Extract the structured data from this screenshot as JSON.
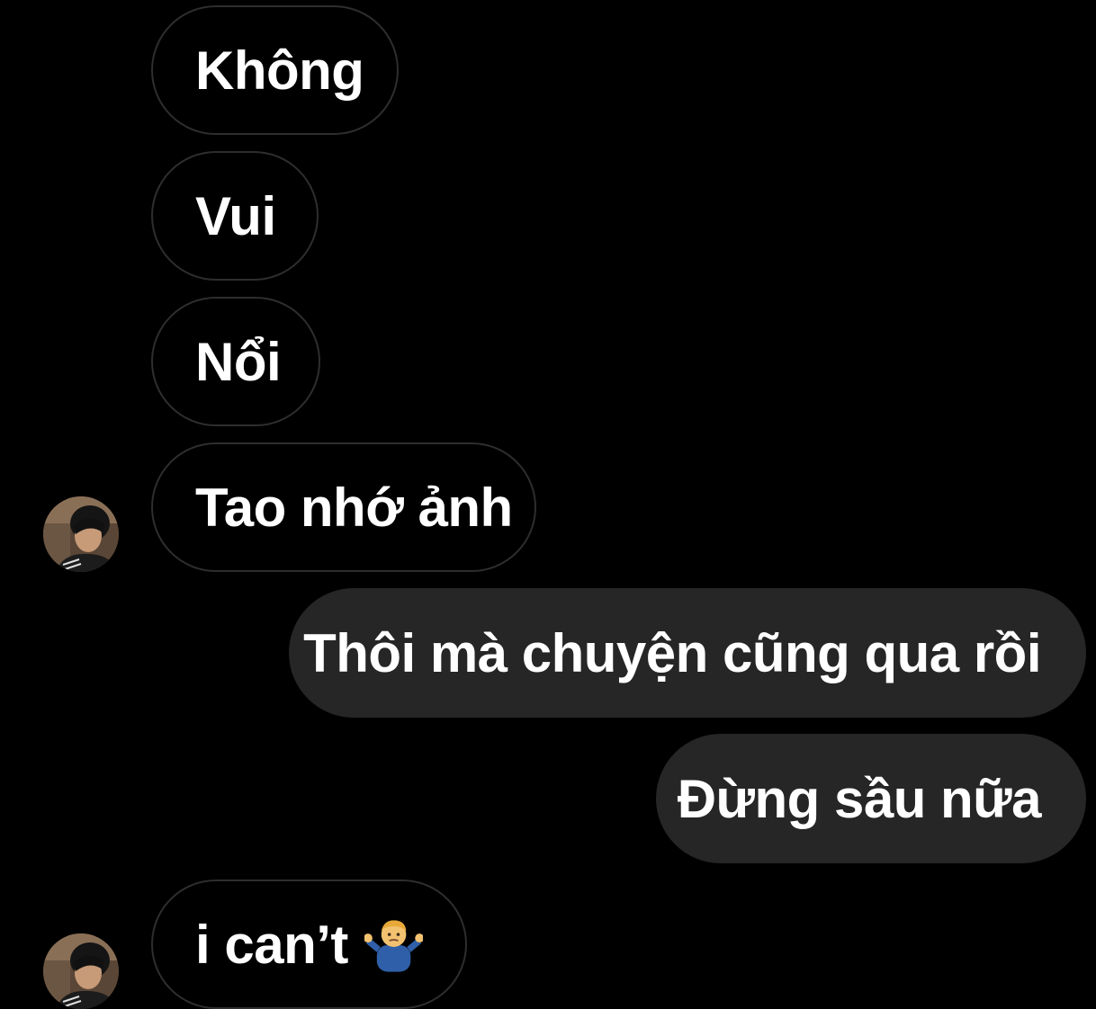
{
  "messages": [
    {
      "direction": "incoming",
      "text": "Không"
    },
    {
      "direction": "incoming",
      "text": "Vui"
    },
    {
      "direction": "incoming",
      "text": "Nổi"
    },
    {
      "direction": "incoming",
      "text": "Tao nhớ ảnh",
      "avatar": true
    },
    {
      "direction": "outgoing",
      "text": "Thôi mà chuyện cũng qua rồi"
    },
    {
      "direction": "outgoing",
      "text": "Đừng sầu nữa"
    },
    {
      "direction": "incoming",
      "text": "i can’t",
      "emoji": "person-shrugging-emoji",
      "avatar": true
    }
  ],
  "colors": {
    "background": "#000000",
    "incoming_border": "#2e2e2e",
    "outgoing_bubble": "#262626",
    "text": "#ffffff"
  },
  "icons": {
    "avatar": "contact-avatar-photo",
    "emoji": "person-shrugging-emoji"
  }
}
